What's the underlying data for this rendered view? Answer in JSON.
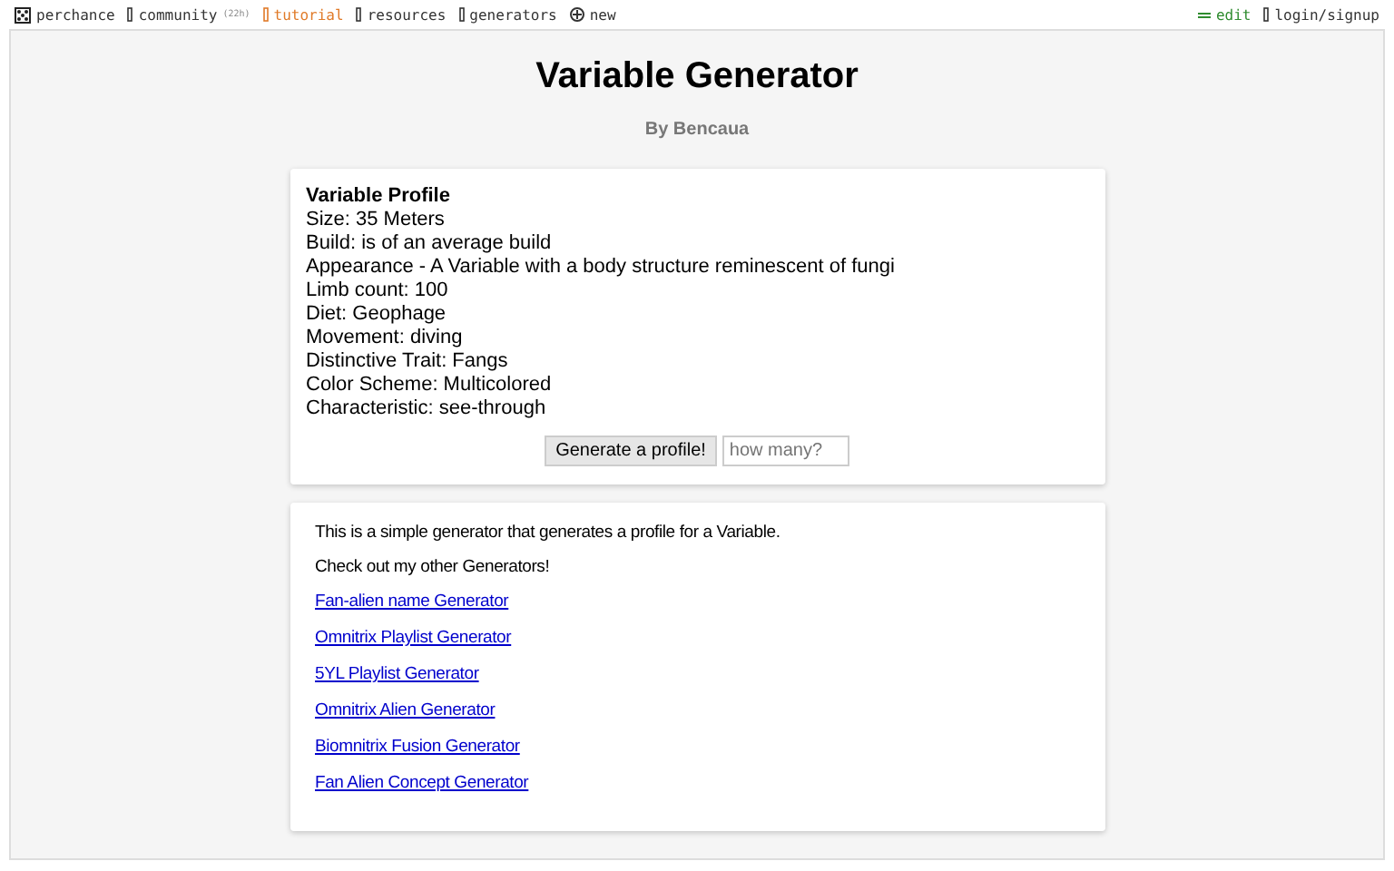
{
  "nav": {
    "left": [
      {
        "label": "perchance",
        "kind": "home"
      },
      {
        "label": "community",
        "kind": "link",
        "badge": "(22h)"
      },
      {
        "label": "tutorial",
        "kind": "highlight"
      },
      {
        "label": "resources",
        "kind": "link"
      },
      {
        "label": "generators",
        "kind": "link"
      },
      {
        "label": "new",
        "kind": "new"
      }
    ],
    "right": [
      {
        "label": "edit",
        "kind": "edit"
      },
      {
        "label": "login/signup",
        "kind": "link"
      }
    ]
  },
  "title": "Variable Generator",
  "byline": "By Bencaua",
  "profile": {
    "heading": "Variable Profile",
    "lines": [
      "Size: 35 Meters",
      "Build: is of an average build",
      "Appearance - A Variable with a body structure reminescent of fungi",
      "Limb count: 100",
      "Diet: Geophage",
      "Movement: diving",
      "Distinctive Trait: Fangs",
      "Color Scheme: Multicolored",
      "Characteristic: see-through"
    ],
    "button": "Generate a profile!",
    "count_placeholder": "how many?"
  },
  "info": {
    "paragraphs": [
      "This is a simple generator that generates a profile for a Variable.",
      "Check out my other Generators!"
    ],
    "links": [
      "Fan-alien name Generator",
      "Omnitrix Playlist Generator",
      "5YL Playlist Generator",
      "Omnitrix Alien Generator",
      "Biomnitrix Fusion Generator",
      "Fan Alien Concept Generator"
    ]
  }
}
